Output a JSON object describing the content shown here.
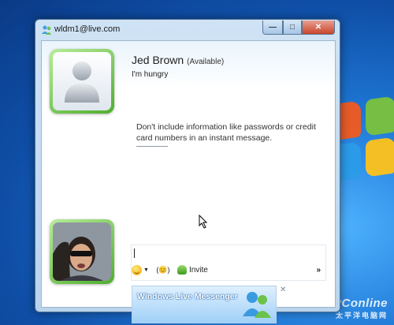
{
  "window": {
    "title": "wldm1@live.com",
    "buttons": {
      "minimize": "—",
      "maximize": "□",
      "close": "✕"
    }
  },
  "contact": {
    "name": "Jed Brown",
    "status": "(Available)",
    "personal_message": "I'm hungry"
  },
  "conversation": {
    "notice": "Don't include information like passwords or credit card numbers in an instant message."
  },
  "input_toolbar": {
    "invite_label": "Invite",
    "more_label": "»"
  },
  "ad": {
    "text": "Windows Live Messenger",
    "close": "✕"
  },
  "watermark": {
    "brand": "PConline",
    "sub": "太平洋电脑网"
  },
  "colors": {
    "avatar_frame": "#4fae2d",
    "titlebar": "#cfe3f5",
    "close_button": "#c9452b"
  }
}
